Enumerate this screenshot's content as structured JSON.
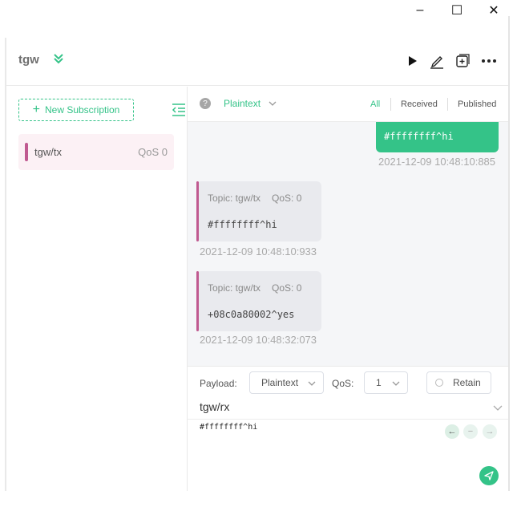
{
  "window": {
    "minimize_glyph": "–",
    "maximize_glyph": "☐",
    "close_glyph": "✕"
  },
  "header": {
    "connection_name": "tgw",
    "icons": [
      "chevrons-down-icon",
      "play-icon",
      "edit-icon",
      "new-window-icon",
      "more-icon"
    ]
  },
  "sidebar": {
    "new_subscription_label": "New Subscription",
    "subscriptions": [
      {
        "topic": "tgw/tx",
        "qos": "QoS 0",
        "color": "#c05a90"
      }
    ]
  },
  "toolbar": {
    "format": "Plaintext",
    "filters": [
      "All",
      "Received",
      "Published"
    ],
    "active_filter": "All"
  },
  "messages": [
    {
      "direction": "out",
      "payload": "#ffffffff^hi",
      "time": "2021-12-09 10:48:10:885"
    },
    {
      "direction": "in",
      "topic": "Topic: tgw/tx",
      "qos": "QoS: 0",
      "payload": "#ffffffff^hi",
      "time": "2021-12-09 10:48:10:933"
    },
    {
      "direction": "in",
      "topic": "Topic: tgw/tx",
      "qos": "QoS: 0",
      "payload": "+08c0a80002^yes",
      "time": "2021-12-09 10:48:32:073"
    }
  ],
  "composer": {
    "payload_label": "Payload:",
    "payload_format": "Plaintext",
    "qos_label": "QoS:",
    "qos_value": "1",
    "retain_label": "Retain",
    "topic": "tgw/rx",
    "payload": "#ffffffff^hi"
  },
  "colors": {
    "accent": "#34c388",
    "subscription": "#c05a90",
    "panel_bg": "#f5f6f8"
  }
}
